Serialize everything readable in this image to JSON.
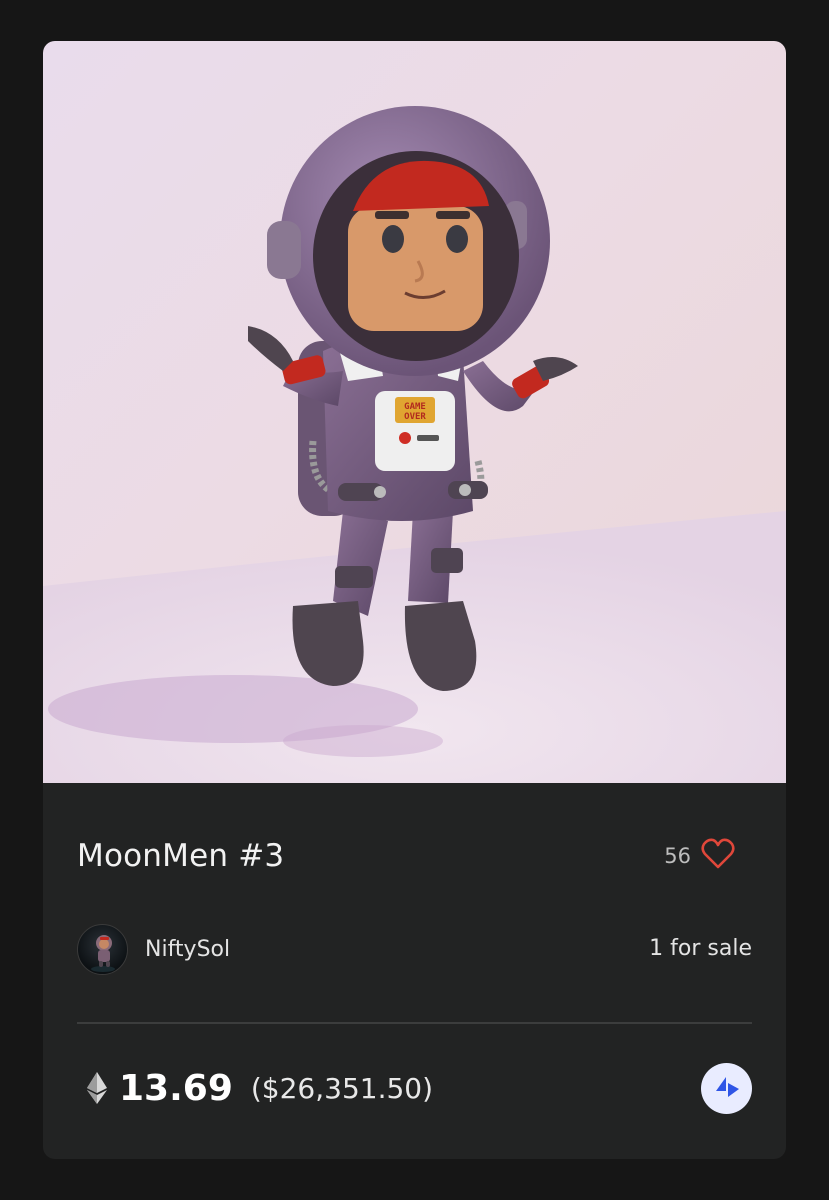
{
  "nft": {
    "title": "MoonMen #3",
    "likes": "56",
    "creator": "NiftySol",
    "availability": "1 for sale",
    "price_eth": "13.69",
    "price_usd": "($26,351.50)",
    "chest_badge": "GAME OVER"
  },
  "icons": {
    "like": "heart-icon",
    "currency": "ethereum-icon",
    "marketplace": "marketplace-logo-icon"
  },
  "colors": {
    "page_bg": "#161616",
    "card_bg": "#222323",
    "heart": "#e0473a",
    "market_icon": "#2f55e6"
  }
}
